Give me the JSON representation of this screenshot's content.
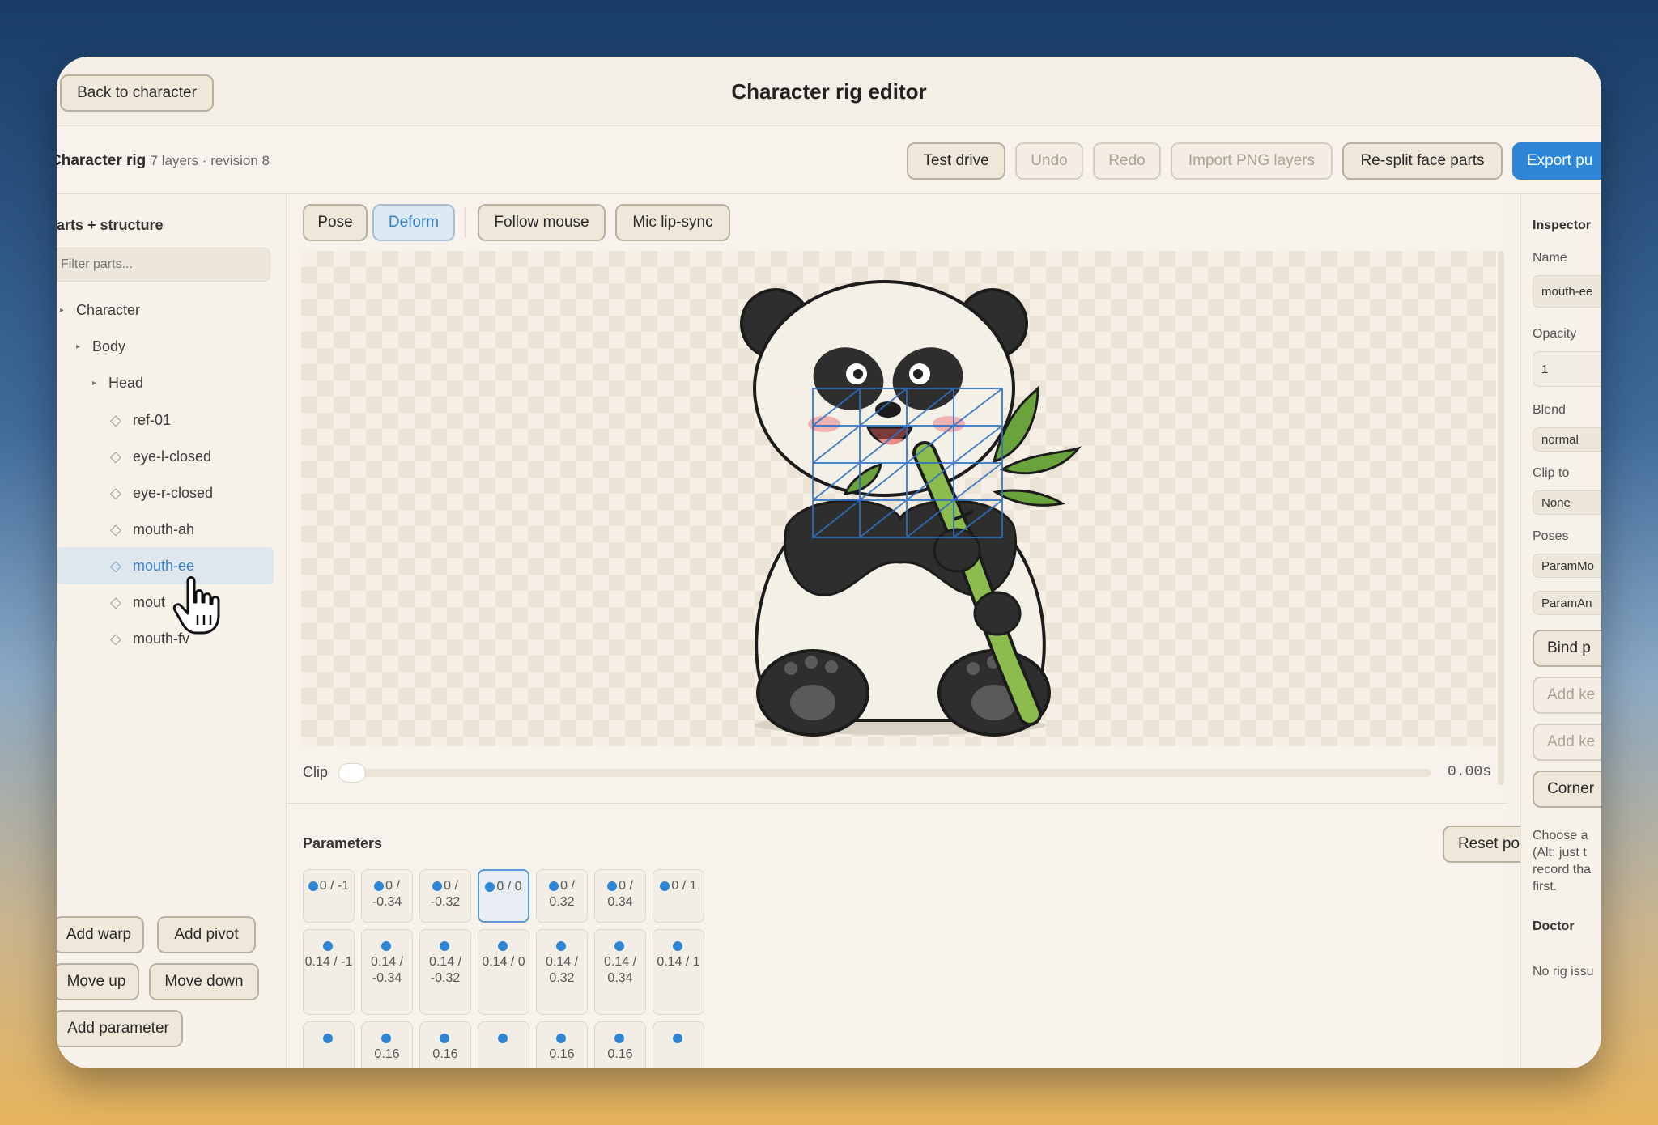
{
  "window": {
    "title": "Character rig editor",
    "back_label": "Back to character"
  },
  "subheader": {
    "rig_name": "Character rig",
    "rig_meta": "7 layers · revision 8",
    "actions": [
      "Test drive",
      "Undo",
      "Redo",
      "Import PNG layers",
      "Re-split face parts",
      "Export pu"
    ]
  },
  "left_panel": {
    "heading": "arts + structure",
    "filter_placeholder": "Filter parts...",
    "tree": [
      {
        "label": "Character",
        "type": "group"
      },
      {
        "label": "Body",
        "type": "group"
      },
      {
        "label": "Head",
        "type": "group"
      },
      {
        "label": "ref-01",
        "type": "layer"
      },
      {
        "label": "eye-l-closed",
        "type": "layer"
      },
      {
        "label": "eye-r-closed",
        "type": "layer"
      },
      {
        "label": "mouth-ah",
        "type": "layer"
      },
      {
        "label": "mouth-ee",
        "type": "layer",
        "selected": true
      },
      {
        "label": "mout",
        "type": "layer"
      },
      {
        "label": "mouth-fv",
        "type": "layer"
      }
    ],
    "buttons": {
      "add_warp": "Add warp",
      "add_pivot": "Add pivot",
      "move_up": "Move up",
      "move_down": "Move down",
      "add_parameter": "Add parameter"
    }
  },
  "toolbar": {
    "pose": "Pose",
    "deform": "Deform",
    "follow_mouse": "Follow mouse",
    "mic_lip_sync": "Mic lip-sync",
    "active_mode": "Deform"
  },
  "timeline": {
    "label": "Clip",
    "time": "0.00s",
    "progress": 0.0
  },
  "parameters": {
    "heading": "Parameters",
    "reset_label": "Reset pose",
    "row1": [
      "0 / -1",
      "0 / -0.34",
      "0 / -0.32",
      "0 / 0",
      "0 / 0.32",
      "0 / 0.34",
      "0 / 1"
    ],
    "row2": [
      "0.14 / -1",
      "0.14 / -0.34",
      "0.14 / -0.32",
      "0.14 / 0",
      "0.14 / 0.32",
      "0.14 / 0.34",
      "0.14 / 1"
    ],
    "row3": [
      "",
      "0.16",
      "0.16",
      "",
      "0.16",
      "0.16",
      ""
    ],
    "selected_index": 3
  },
  "inspector": {
    "heading": "Inspector",
    "name_label": "Name",
    "name_value": "mouth-ee",
    "opacity_label": "Opacity",
    "opacity_value": "1",
    "blend_label": "Blend",
    "blend_value": "normal",
    "clip_label": "Clip to",
    "clip_value": "None",
    "poses_label": "Poses",
    "pose1": "ParamMo",
    "pose2": "ParamAn",
    "bind": "Bind p",
    "add_key1": "Add ke",
    "add_key2": "Add ke",
    "corner": "Corner",
    "help": "Choose a (Alt: just t record tha first.",
    "doctor_label": "Doctor",
    "doctor_text": "No rig issu"
  },
  "colors": {
    "accent": "#2f86d6",
    "panel": "#f6f2ea",
    "mesh": "#2f6fc0"
  }
}
